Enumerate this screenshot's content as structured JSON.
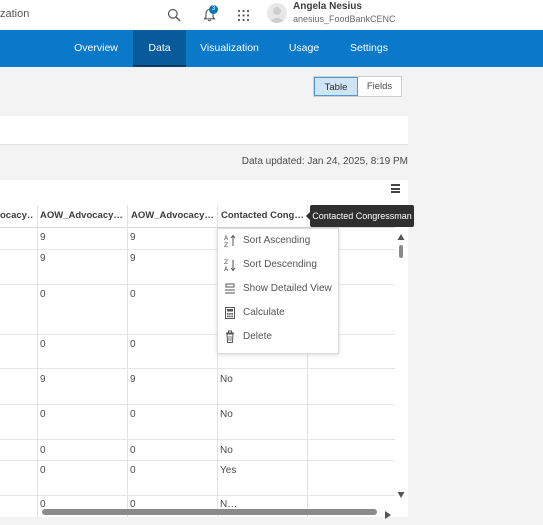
{
  "topbar": {
    "title_fragment": "zation",
    "notification_count": "3"
  },
  "user": {
    "name": "Angela Nesius",
    "username": "anesius_FoodBankCENC"
  },
  "nav": {
    "tabs": [
      {
        "label": "Overview"
      },
      {
        "label": "Data"
      },
      {
        "label": "Visualization"
      },
      {
        "label": "Usage"
      },
      {
        "label": "Settings"
      }
    ],
    "active": "Data"
  },
  "view_toggle": {
    "table_label": "Table",
    "fields_label": "Fields",
    "selected": "Table"
  },
  "data_updated": "Data updated: Jan 24, 2025, 8:19 PM",
  "table": {
    "columns": [
      "ocacy…",
      "AOW_Advocacy…",
      "AOW_Advocacy…",
      "Contacted Cong…"
    ],
    "rows": [
      [
        "",
        "9",
        "9",
        ""
      ],
      [
        "",
        "9",
        "9",
        ""
      ],
      [
        "",
        "0",
        "0",
        ""
      ],
      [
        "",
        "0",
        "0",
        ""
      ],
      [
        "",
        "9",
        "9",
        "No"
      ],
      [
        "",
        "0",
        "0",
        "No"
      ],
      [
        "",
        "0",
        "0",
        "No"
      ],
      [
        "",
        "0",
        "0",
        "Yes"
      ],
      [
        "",
        "0",
        "0",
        "N…"
      ]
    ]
  },
  "tooltip": "Contacted Congressman",
  "context_menu": [
    {
      "label": "Sort Ascending",
      "icon": "sort-ascending-icon"
    },
    {
      "label": "Sort Descending",
      "icon": "sort-descending-icon"
    },
    {
      "label": "Show Detailed View",
      "icon": "detailed-view-icon"
    },
    {
      "label": "Calculate",
      "icon": "calculator-icon"
    },
    {
      "label": "Delete",
      "icon": "trash-icon"
    }
  ],
  "colors": {
    "brand_blue": "#0b79c9",
    "active_tab": "#075b9b",
    "badge": "#0079c1",
    "toggle_selected": "#cfe4f4"
  }
}
